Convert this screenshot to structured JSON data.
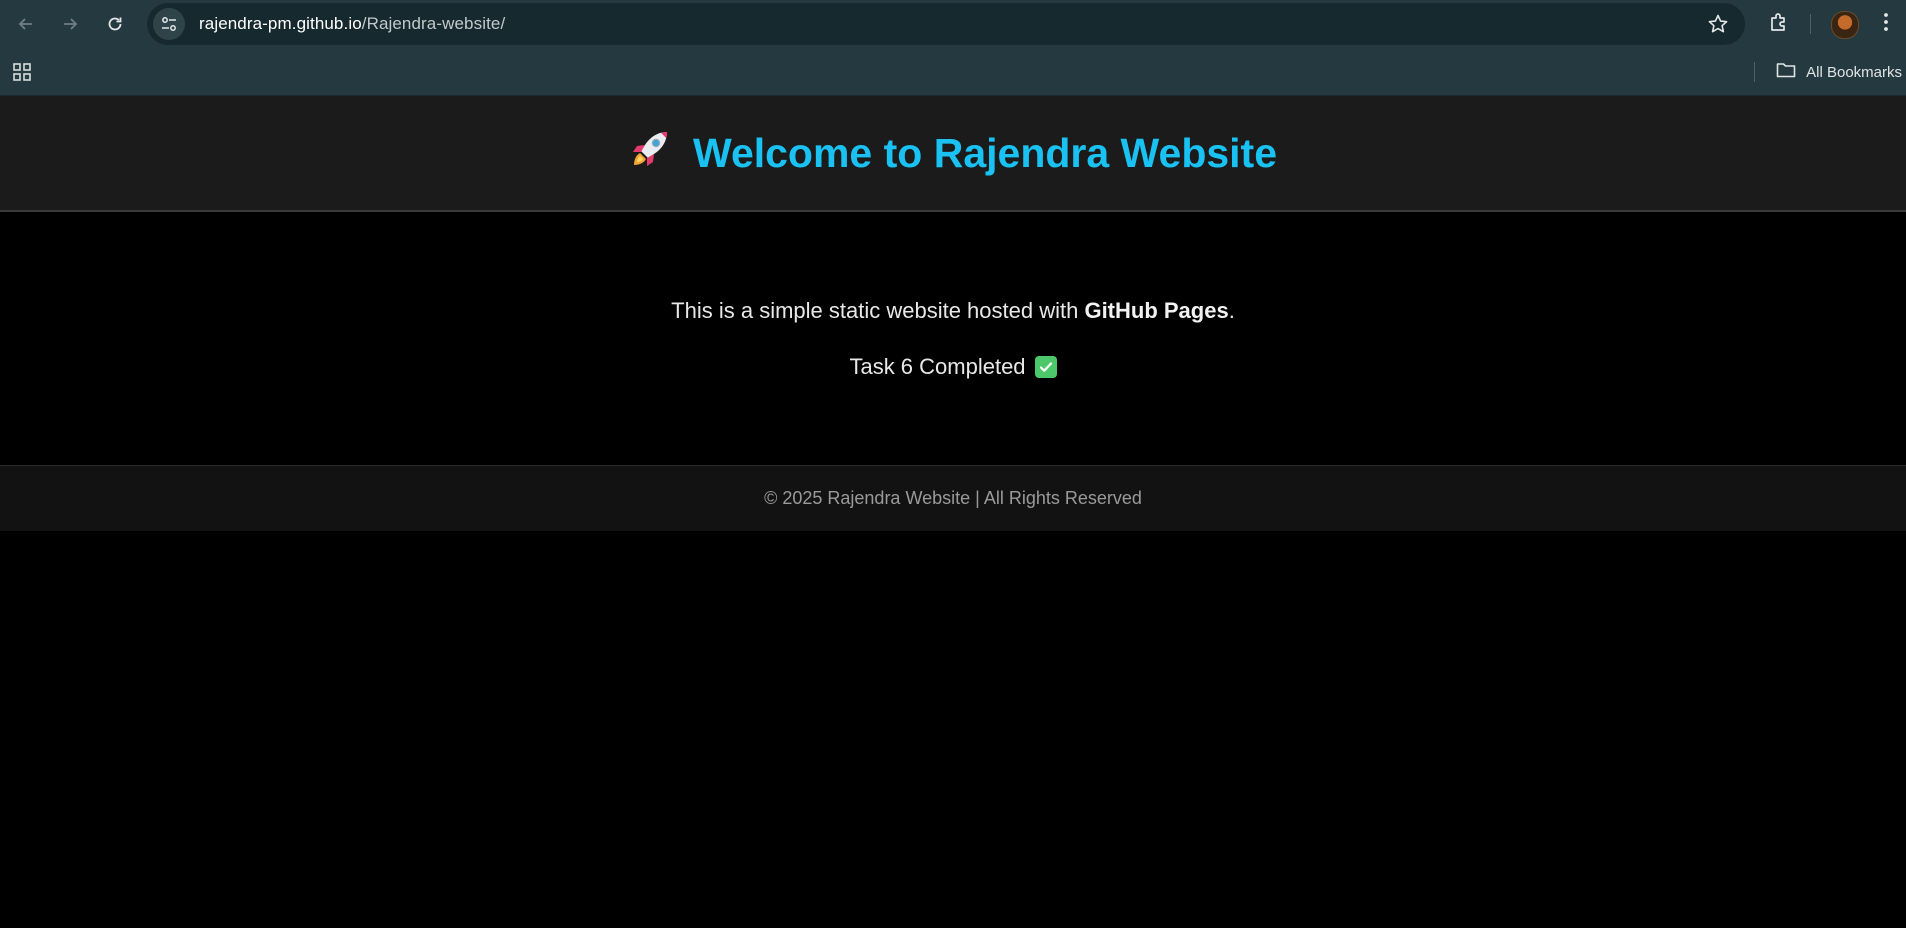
{
  "browser": {
    "url_host": "rajendra-pm.github.io",
    "url_path": "/Rajendra-website/",
    "bookmarks_label": "All Bookmarks"
  },
  "page": {
    "title": "Welcome to Rajendra Website",
    "intro_prefix": "This is a simple static website hosted with ",
    "intro_bold": "GitHub Pages",
    "intro_suffix": ".",
    "task_text": "Task 6 Completed",
    "footer": "© 2025 Rajendra Website | All Rights Reserved"
  },
  "colors": {
    "title": "#19c2f2",
    "check": "#4cc86a",
    "chrome": "#253a40"
  },
  "icons": [
    "back-icon",
    "forward-icon",
    "reload-icon",
    "site-info-icon",
    "bookmark-star-icon",
    "extensions-icon",
    "menu-icon",
    "apps-icon",
    "folder-icon",
    "rocket-icon",
    "check-icon"
  ]
}
